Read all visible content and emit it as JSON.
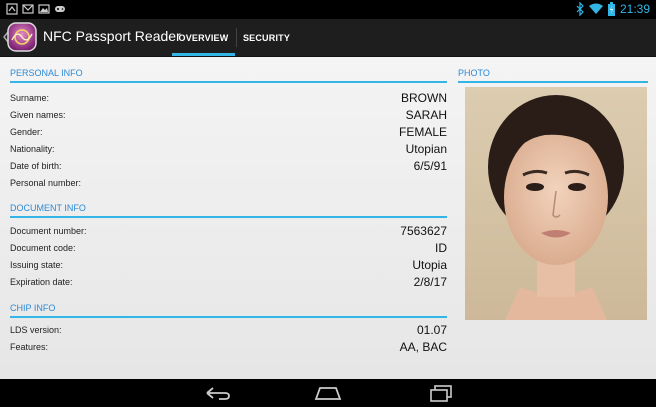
{
  "status_bar": {
    "left_icons": [
      "notification-icon",
      "gmail-icon",
      "image-icon",
      "game-controller-icon"
    ],
    "right_icons": [
      "bluetooth-icon",
      "wifi-icon",
      "battery-icon"
    ],
    "time": "21:39",
    "accent_color": "#33b5e5"
  },
  "action_bar": {
    "title": "NFC Passport Reader",
    "tabs": [
      {
        "label": "OVERVIEW",
        "selected": true
      },
      {
        "label": "SECURITY",
        "selected": false
      }
    ]
  },
  "personal_info": {
    "header": "PERSONAL INFO",
    "rows": [
      {
        "label": "Surname:",
        "value": "BROWN"
      },
      {
        "label": "Given names:",
        "value": "SARAH"
      },
      {
        "label": "Gender:",
        "value": "FEMALE"
      },
      {
        "label": "Nationality:",
        "value": "Utopian"
      },
      {
        "label": "Date of birth:",
        "value": "6/5/91"
      },
      {
        "label": "Personal number:",
        "value": ""
      }
    ]
  },
  "document_info": {
    "header": "DOCUMENT INFO",
    "rows": [
      {
        "label": "Document number:",
        "value": "7563627"
      },
      {
        "label": "Document code:",
        "value": "ID"
      },
      {
        "label": "Issuing state:",
        "value": "Utopia"
      },
      {
        "label": "Expiration date:",
        "value": "2/8/17"
      }
    ]
  },
  "chip_info": {
    "header": "CHIP INFO",
    "rows": [
      {
        "label": "LDS version:",
        "value": "01.07"
      },
      {
        "label": "Features:",
        "value": "AA, BAC"
      }
    ]
  },
  "photo": {
    "header": "PHOTO"
  },
  "nav_bar": {
    "buttons": [
      "back-icon",
      "home-icon",
      "recent-apps-icon"
    ]
  }
}
